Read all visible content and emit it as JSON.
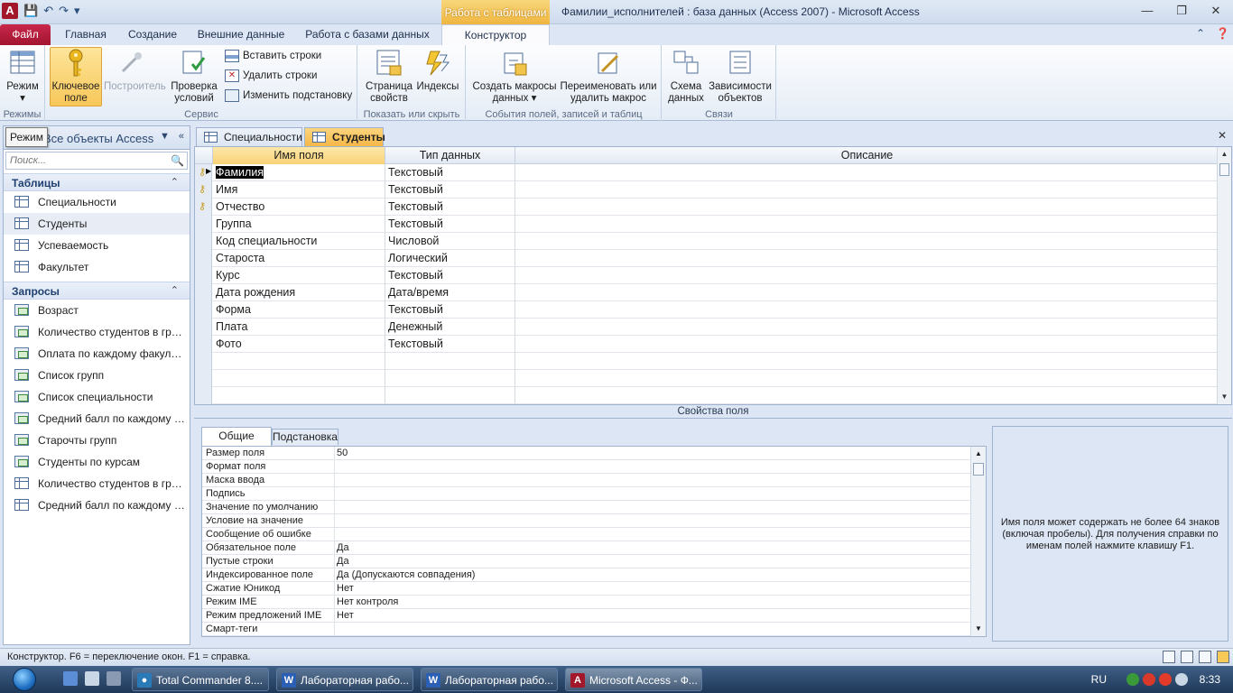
{
  "window": {
    "title": "Фамилии_исполнителей : база данных (Access 2007)  -  Microsoft Access",
    "context_tab_header": "Работа с таблицами",
    "app_letter": "A"
  },
  "ribbon_tabs": [
    "Файл",
    "Главная",
    "Создание",
    "Внешние данные",
    "Работа с базами данных",
    "Конструктор"
  ],
  "ribbon": {
    "mode_label": "Режим",
    "mode_group": "Режимы",
    "key_field": "Ключевое поле",
    "builder": "Построитель",
    "validate": "Проверка условий",
    "insert_rows": "Вставить строки",
    "delete_rows": "Удалить строки",
    "modify_lookups": "Изменить подстановку",
    "service_group": "Сервис",
    "property_sheet": "Страница свойств",
    "indexes": "Индексы",
    "show_hide_group": "Показать или скрыть",
    "create_macros": "Создать макросы данных",
    "rename_macro": "Переименовать или удалить макрос",
    "events_group": "События полей, записей и таблиц",
    "relationships": "Схема данных",
    "dependencies": "Зависимости объектов",
    "relations_group": "Связи"
  },
  "nav": {
    "title": "Все объекты Access",
    "tooltip": "Режим",
    "search_placeholder": "Поиск...",
    "tables_header": "Таблицы",
    "tables": [
      "Специальности",
      "Студенты",
      "Успеваемость",
      "Факультет"
    ],
    "queries_header": "Запросы",
    "queries": [
      "Возраст",
      "Количество студентов в группах",
      "Оплата по каждому факультету",
      "Список групп",
      "Список специальности",
      "Средний балл по каждому курсу",
      "Старочты групп",
      "Студенты по курсам",
      "Количество студентов в группах",
      "Средний балл по каждому курсу"
    ]
  },
  "doc_tabs": [
    "Специальности",
    "Студенты"
  ],
  "grid": {
    "headers": [
      "Имя поля",
      "Тип данных",
      "Описание"
    ],
    "rows": [
      {
        "name": "Фамилия",
        "type": "Текстовый",
        "key": true
      },
      {
        "name": "Имя",
        "type": "Текстовый",
        "key": true
      },
      {
        "name": "Отчество",
        "type": "Текстовый",
        "key": true
      },
      {
        "name": "Группа",
        "type": "Текстовый",
        "key": false
      },
      {
        "name": "Код специальности",
        "type": "Числовой",
        "key": false
      },
      {
        "name": "Староста",
        "type": "Логический",
        "key": false
      },
      {
        "name": "Курс",
        "type": "Текстовый",
        "key": false
      },
      {
        "name": "Дата рождения",
        "type": "Дата/время",
        "key": false
      },
      {
        "name": "Форма",
        "type": "Текстовый",
        "key": false
      },
      {
        "name": "Плата",
        "type": "Денежный",
        "key": false
      },
      {
        "name": "Фото",
        "type": "Текстовый",
        "key": false
      }
    ]
  },
  "props": {
    "title": "Свойства поля",
    "tab_general": "Общие",
    "tab_lookup": "Подстановка",
    "rows": [
      {
        "label": "Размер поля",
        "value": "50"
      },
      {
        "label": "Формат поля",
        "value": ""
      },
      {
        "label": "Маска ввода",
        "value": ""
      },
      {
        "label": "Подпись",
        "value": ""
      },
      {
        "label": "Значение по умолчанию",
        "value": ""
      },
      {
        "label": "Условие на значение",
        "value": ""
      },
      {
        "label": "Сообщение об ошибке",
        "value": ""
      },
      {
        "label": "Обязательное поле",
        "value": "Да"
      },
      {
        "label": "Пустые строки",
        "value": "Да"
      },
      {
        "label": "Индексированное поле",
        "value": "Да (Допускаются совпадения)"
      },
      {
        "label": "Сжатие Юникод",
        "value": "Нет"
      },
      {
        "label": "Режим IME",
        "value": "Нет контроля"
      },
      {
        "label": "Режим предложений IME",
        "value": "Нет"
      },
      {
        "label": "Смарт-теги",
        "value": ""
      }
    ],
    "help": "Имя поля может содержать не более 64 знаков (включая пробелы). Для получения справки по именам полей нажмите клавишу F1."
  },
  "status": "Конструктор.  F6 = переключение окон.  F1 = справка.",
  "taskbar": {
    "tasks": [
      "Total Commander 8....",
      "Лабораторная рабо...",
      "Лабораторная рабо...",
      "Microsoft Access - Ф..."
    ],
    "lang": "RU",
    "time": "8:33"
  }
}
